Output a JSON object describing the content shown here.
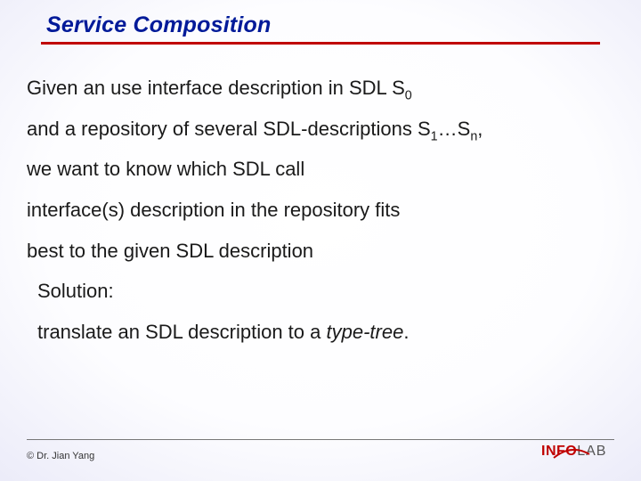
{
  "title": "Service Composition",
  "paragraph1": {
    "l1a": "Given an use interface description in SDL S",
    "l1sub": "0",
    "l2a": "and a repository of several SDL-descriptions S",
    "l2sub1": "1",
    "l2mid": "…S",
    "l2sub2": "n",
    "l2end": ",",
    "l3": "we want to know which SDL call",
    "l4": "interface(s) description in the repository fits",
    "l5": "best to the given SDL description"
  },
  "paragraph2": {
    "l1": "Solution:",
    "l2a": "translate an SDL description to a ",
    "l2em": "type-tree",
    "l2end": "."
  },
  "copyright": "© Dr. Jian Yang",
  "logo": {
    "part1": "INFO",
    "part2": "LAB"
  }
}
